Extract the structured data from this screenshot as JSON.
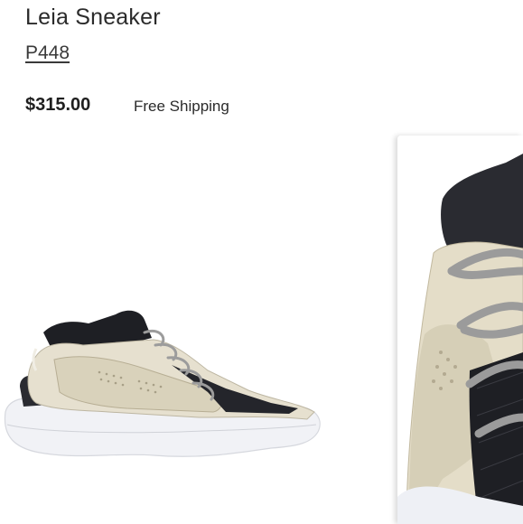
{
  "product": {
    "title": "Leia Sneaker",
    "brand": "P448",
    "price": "$315.00",
    "shipping": "Free Shipping"
  },
  "gallery": {
    "main_image_icon": "sneaker-side-view",
    "zoom_image_icon": "sneaker-zoomed-detail"
  },
  "colors": {
    "text": "#2b2b2b",
    "sneaker_upper": "#e6e0cf",
    "sneaker_dark": "#1e1f24",
    "sole": "#f1f2f6"
  }
}
